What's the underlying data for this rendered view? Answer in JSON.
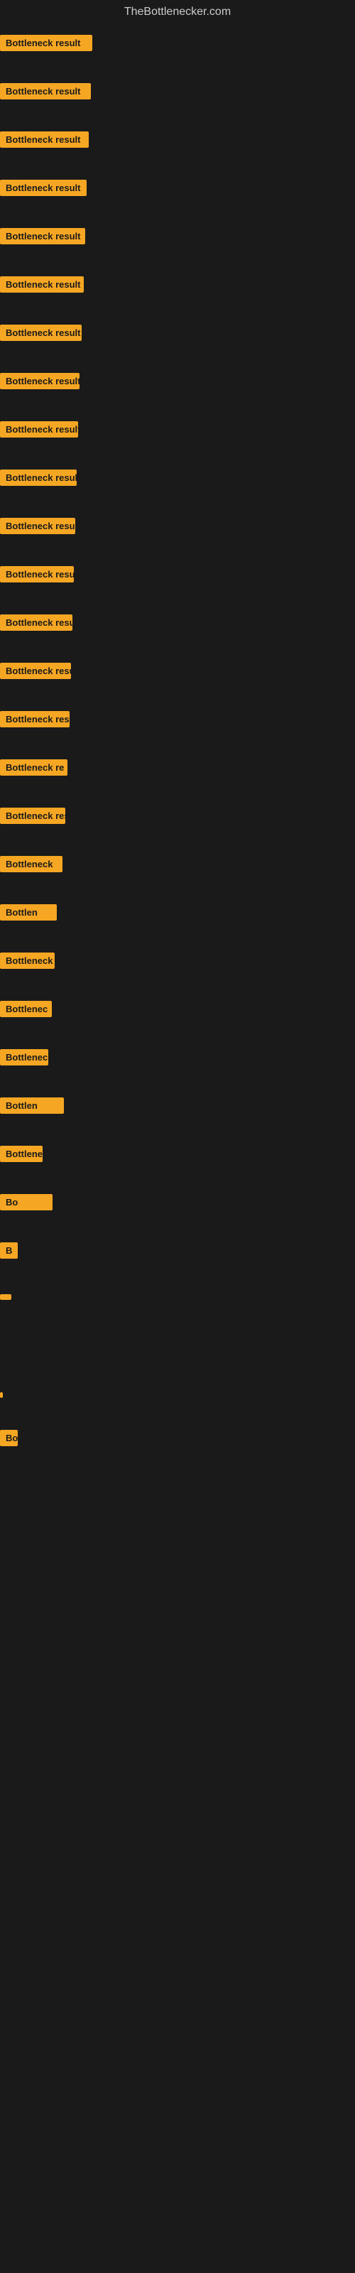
{
  "site": {
    "title": "TheBottlenecker.com"
  },
  "rows": [
    {
      "id": 1,
      "label": "Bottleneck result"
    },
    {
      "id": 2,
      "label": "Bottleneck result"
    },
    {
      "id": 3,
      "label": "Bottleneck result"
    },
    {
      "id": 4,
      "label": "Bottleneck result"
    },
    {
      "id": 5,
      "label": "Bottleneck result"
    },
    {
      "id": 6,
      "label": "Bottleneck result"
    },
    {
      "id": 7,
      "label": "Bottleneck result"
    },
    {
      "id": 8,
      "label": "Bottleneck result"
    },
    {
      "id": 9,
      "label": "Bottleneck result"
    },
    {
      "id": 10,
      "label": "Bottleneck result"
    },
    {
      "id": 11,
      "label": "Bottleneck result"
    },
    {
      "id": 12,
      "label": "Bottleneck result"
    },
    {
      "id": 13,
      "label": "Bottleneck result"
    },
    {
      "id": 14,
      "label": "Bottleneck result"
    },
    {
      "id": 15,
      "label": "Bottleneck result"
    },
    {
      "id": 16,
      "label": "Bottleneck re"
    },
    {
      "id": 17,
      "label": "Bottleneck resul"
    },
    {
      "id": 18,
      "label": "Bottleneck"
    },
    {
      "id": 19,
      "label": "Bottlen"
    },
    {
      "id": 20,
      "label": "Bottleneck"
    },
    {
      "id": 21,
      "label": "Bottlenec"
    },
    {
      "id": 22,
      "label": "Bottleneck re"
    },
    {
      "id": 23,
      "label": "Bottlen"
    },
    {
      "id": 24,
      "label": "Bottleneck"
    },
    {
      "id": 25,
      "label": "Bo"
    },
    {
      "id": 26,
      "label": "B"
    },
    {
      "id": 27,
      "label": ""
    },
    {
      "id": 28,
      "label": ""
    },
    {
      "id": 29,
      "label": ""
    },
    {
      "id": 30,
      "label": "|"
    },
    {
      "id": 31,
      "label": ""
    },
    {
      "id": 32,
      "label": "Bot"
    },
    {
      "id": 33,
      "label": ""
    },
    {
      "id": 34,
      "label": ""
    },
    {
      "id": 35,
      "label": ""
    },
    {
      "id": 36,
      "label": ""
    }
  ],
  "colors": {
    "background": "#1a1a1a",
    "label_bg": "#f5a623",
    "label_text": "#1a1a1a",
    "site_title": "#cccccc"
  }
}
